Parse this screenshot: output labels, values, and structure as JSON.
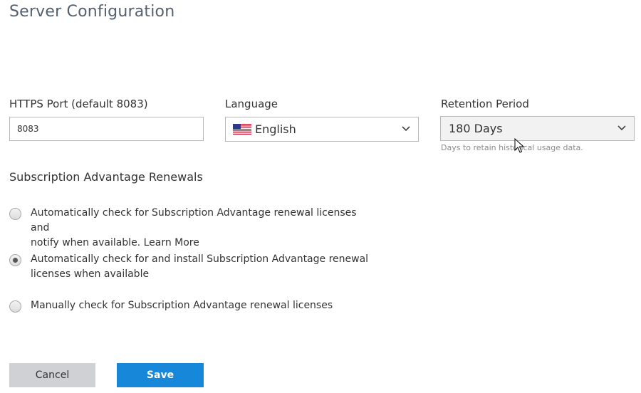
{
  "header": {
    "title": "Server Configuration"
  },
  "https_port": {
    "label": "HTTPS Port (default 8083)",
    "value": "8083"
  },
  "language": {
    "label": "Language",
    "selected": "English",
    "flag_icon": "us-flag-icon"
  },
  "retention": {
    "label": "Retention Period",
    "selected": "180 Days",
    "help": "Days to retain historical usage data."
  },
  "renewals": {
    "title": "Subscription Advantage Renewals",
    "options": [
      {
        "label_line1": "Automatically check for Subscription Advantage renewal licenses and",
        "label_line2": "notify when available. Learn More",
        "checked": false
      },
      {
        "label_line1": "Automatically check for and install Subscription Advantage renewal",
        "label_line2": "licenses when available",
        "checked": true
      },
      {
        "label_line1": "Manually check for Subscription Advantage renewal licenses",
        "label_line2": "",
        "checked": false
      }
    ]
  },
  "buttons": {
    "cancel": "Cancel",
    "save": "Save"
  },
  "colors": {
    "primary": "#1788d9",
    "secondary": "#cfd1d4",
    "title": "#55606e"
  }
}
